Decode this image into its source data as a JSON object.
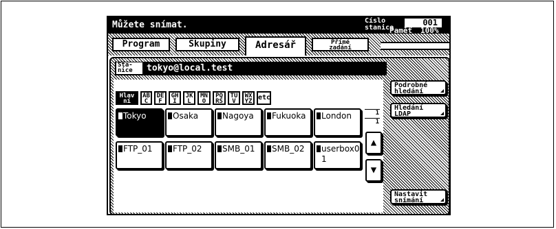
{
  "header": {
    "title": "Můžete snímat.",
    "station_label_line1": "Číslo",
    "station_label_line2": "stanice",
    "station_number": "001",
    "memory_label": "Paměť",
    "memory_value": "100%"
  },
  "tabs": [
    {
      "label": "Program",
      "active": false
    },
    {
      "label": "Skupiny",
      "active": false
    },
    {
      "label": "Adresář",
      "active": true
    },
    {
      "label_line1": "Přímé",
      "label_line2": "zadání",
      "active": false
    }
  ],
  "station_row": {
    "label_line1": "Sta-",
    "label_line2": "nice",
    "value": "tokyo@local.test"
  },
  "index_tabs": [
    {
      "l1": "Hlav",
      "l2": "ní",
      "active": true
    },
    {
      "l1": "AB",
      "l2": "C"
    },
    {
      "l1": "DE",
      "l2": "F"
    },
    {
      "l1": "GH",
      "l2": "I"
    },
    {
      "l1": "JK",
      "l2": "L"
    },
    {
      "l1": "MN",
      "l2": "O"
    },
    {
      "l1": "PQ",
      "l2": "RS"
    },
    {
      "l1": "TU",
      "l2": "V"
    },
    {
      "l1": "WX",
      "l2": "YZ"
    },
    {
      "l1": "etc",
      "l2": ""
    }
  ],
  "page": {
    "current": "1",
    "total": "1"
  },
  "entries": [
    {
      "name": "Tokyo",
      "selected": true
    },
    {
      "name": "Osaka"
    },
    {
      "name": "Nagoya"
    },
    {
      "name": "Fukuoka"
    },
    {
      "name": "London"
    },
    {
      "name": "FTP_01"
    },
    {
      "name": "FTP_02"
    },
    {
      "name": "SMB_01"
    },
    {
      "name": "SMB_02"
    },
    {
      "name": "userbox01"
    }
  ],
  "side_buttons": {
    "detail_search_l1": "Podrobné",
    "detail_search_l2": "hledání",
    "ldap_search_l1": "Hledání",
    "ldap_search_l2": "LDAP",
    "scan_settings_l1": "Nastavit",
    "scan_settings_l2": "snímání"
  }
}
